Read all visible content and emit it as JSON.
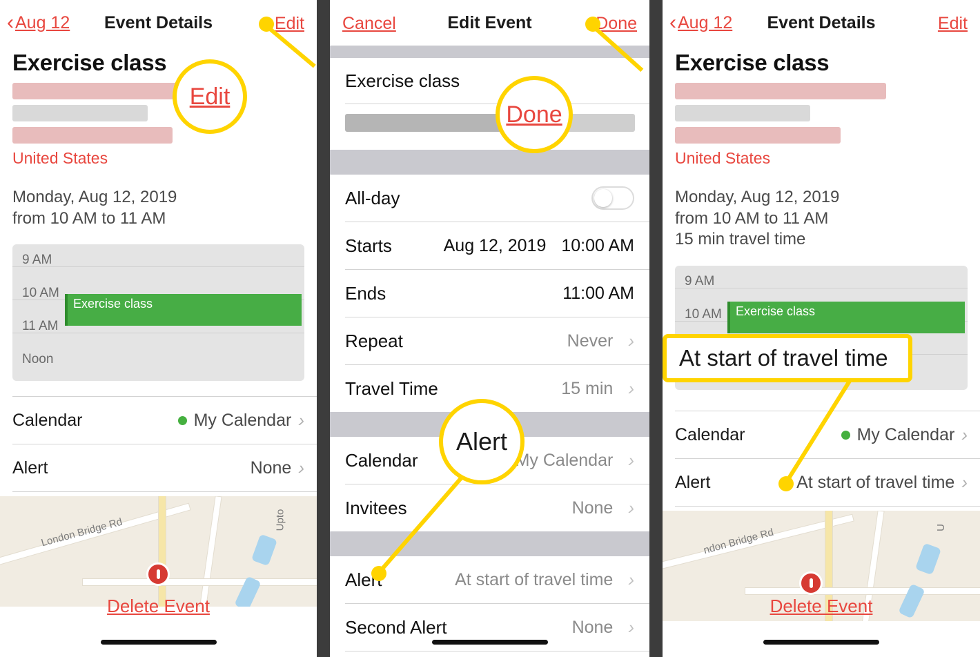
{
  "screens": [
    {
      "id": "event-details-before",
      "nav": {
        "back_label": "Aug 12",
        "title": "Event Details",
        "action_right": "Edit"
      },
      "event": {
        "title": "Exercise class",
        "country": "United States",
        "when_line1": "Monday, Aug 12, 2019",
        "when_line2": "from 10 AM to 11 AM",
        "when_line3": ""
      },
      "mini_calendar": {
        "hours": [
          "9 AM",
          "10 AM",
          "11 AM",
          "Noon"
        ],
        "event_label": "Exercise class",
        "event_color": "#47ad45"
      },
      "rows": [
        {
          "label": "Calendar",
          "value": "My Calendar",
          "has_dot": true,
          "dot_color": "#45b03f",
          "chevron": "›"
        },
        {
          "label": "Alert",
          "value": "None",
          "has_dot": false,
          "chevron": "›"
        }
      ],
      "map": {
        "street_label": "London Bridge Rd",
        "street_label2": "Upto"
      },
      "delete_label": "Delete Event",
      "callout": {
        "text": "Edit",
        "style": "link"
      }
    },
    {
      "id": "edit-event",
      "nav": {
        "left_label": "Cancel",
        "title": "Edit Event",
        "action_right": "Done"
      },
      "event": {
        "title": "Exercise class"
      },
      "form_rows": [
        {
          "label": "All-day",
          "type": "toggle",
          "value": "off"
        },
        {
          "label": "Starts",
          "type": "value2",
          "value": "Aug 12, 2019",
          "value2": "10:00 AM"
        },
        {
          "label": "Ends",
          "type": "value",
          "value": "11:00 AM"
        },
        {
          "label": "Repeat",
          "type": "disclosure",
          "value": "Never",
          "chevron": "›"
        },
        {
          "label": "Travel Time",
          "type": "disclosure",
          "value": "15 min",
          "chevron": "›"
        },
        {
          "label": "Calendar",
          "type": "disclosure",
          "value": "My Calendar",
          "chevron": "›"
        },
        {
          "label": "Invitees",
          "type": "disclosure",
          "value": "None",
          "chevron": "›"
        },
        {
          "label": "Alert",
          "type": "disclosure",
          "value": "At start of travel time",
          "chevron": "›"
        },
        {
          "label": "Second Alert",
          "type": "disclosure",
          "value": "None",
          "chevron": "›"
        }
      ],
      "callout_done": {
        "text": "Done",
        "style": "link"
      },
      "callout_alert": {
        "text": "Alert",
        "style": "plain"
      }
    },
    {
      "id": "event-details-after",
      "nav": {
        "back_label": "Aug 12",
        "title": "Event Details",
        "action_right": "Edit"
      },
      "event": {
        "title": "Exercise class",
        "country": "United States",
        "when_line1": "Monday, Aug 12, 2019",
        "when_line2": "from 10 AM to 11 AM",
        "when_line3": "15 min travel time"
      },
      "mini_calendar": {
        "hours": [
          "9 AM",
          "10 AM"
        ],
        "event_label": "Exercise class",
        "event_color": "#47ad45"
      },
      "rows": [
        {
          "label": "Calendar",
          "value": "My Calendar",
          "has_dot": true,
          "dot_color": "#45b03f",
          "chevron": "›"
        },
        {
          "label": "Alert",
          "value": "At start of travel time",
          "has_dot": false,
          "chevron": "›"
        }
      ],
      "map": {
        "street_label": "ndon Bridge Rd",
        "street_label2": "U"
      },
      "delete_label": "Delete Event",
      "callout": {
        "text": "At start of travel time",
        "style": "box"
      }
    }
  ],
  "theme": {
    "accent_red": "#e8473f",
    "highlight_yellow": "#ffd400",
    "event_green": "#47ad45",
    "gray_band": "#c9c9cf",
    "text_primary": "#1a1a1a",
    "text_secondary": "#4a4a4a"
  }
}
